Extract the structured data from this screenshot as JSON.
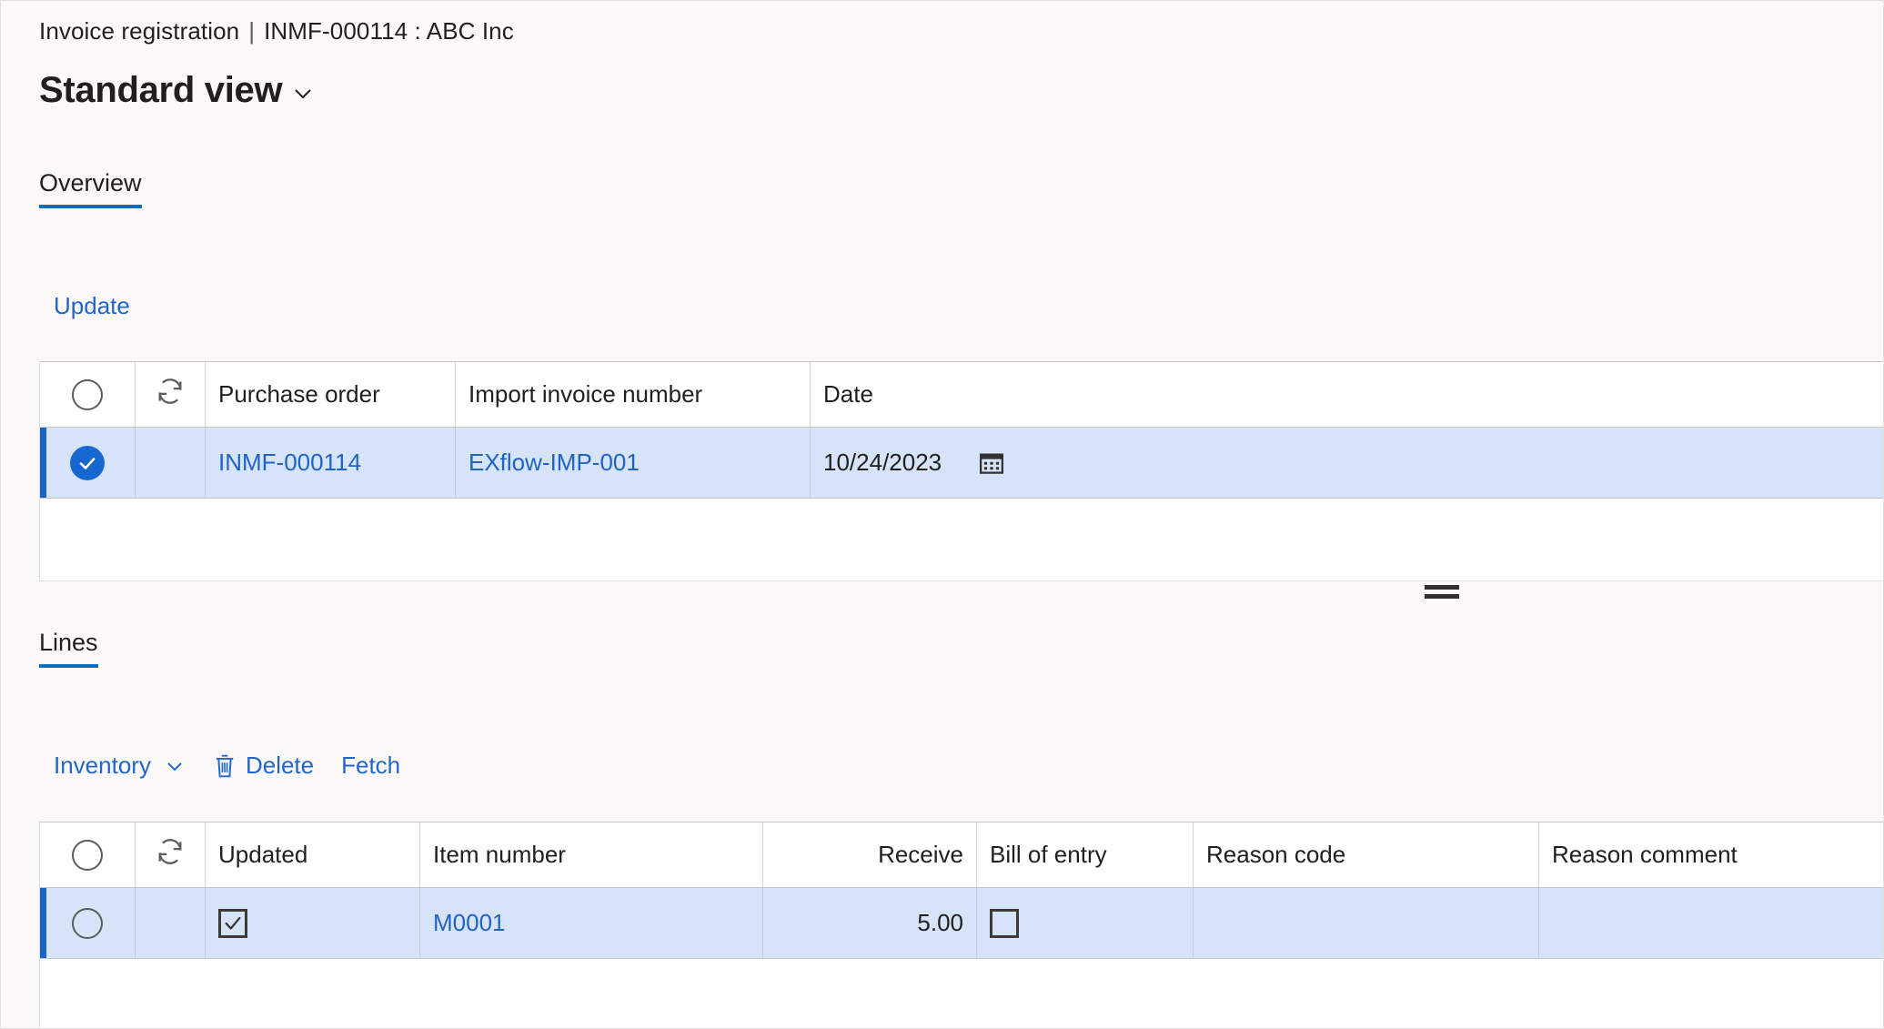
{
  "header": {
    "breadcrumb_primary": "Invoice registration",
    "breadcrumb_separator": "|",
    "breadcrumb_secondary": "INMF-000114 : ABC Inc",
    "page_title": "Standard view",
    "page_title_caret": "chevron-down-icon"
  },
  "tabs": [
    {
      "label": "Overview",
      "active": true
    }
  ],
  "overview": {
    "toolbar": {
      "update_label": "Update"
    },
    "grid": {
      "columns": [
        {
          "key": "select",
          "label": "",
          "icon": "circle-select-all-icon"
        },
        {
          "key": "refresh",
          "label": "",
          "icon": "refresh-icon"
        },
        {
          "key": "purchase_order",
          "label": "Purchase order"
        },
        {
          "key": "import_invoice_number",
          "label": "Import invoice number"
        },
        {
          "key": "date",
          "label": "Date"
        }
      ],
      "rows": [
        {
          "selected": true,
          "purchase_order": "INMF-000114",
          "import_invoice_number": "EXflow-IMP-001",
          "date": "10/24/2023",
          "date_icon": "calendar-icon"
        }
      ]
    }
  },
  "lines": {
    "tabs": [
      {
        "label": "Lines",
        "active": true
      }
    ],
    "toolbar": {
      "inventory_label": "Inventory",
      "inventory_caret": "chevron-down-icon",
      "delete_label": "Delete",
      "delete_icon": "trash-icon",
      "fetch_label": "Fetch"
    },
    "grid": {
      "columns": [
        {
          "key": "select",
          "label": "",
          "icon": "circle-select-all-icon"
        },
        {
          "key": "refresh",
          "label": "",
          "icon": "refresh-icon"
        },
        {
          "key": "updated",
          "label": "Updated"
        },
        {
          "key": "item_number",
          "label": "Item number"
        },
        {
          "key": "receive",
          "label": "Receive"
        },
        {
          "key": "bill_of_entry",
          "label": "Bill of entry"
        },
        {
          "key": "reason_code",
          "label": "Reason code"
        },
        {
          "key": "reason_comment",
          "label": "Reason comment"
        }
      ],
      "rows": [
        {
          "selected": false,
          "updated": true,
          "item_number": "M0001",
          "receive": "5.00",
          "bill_of_entry": false,
          "reason_code": "",
          "reason_comment": ""
        }
      ]
    }
  },
  "colors": {
    "accent": "#0f6cbd",
    "link": "#2266cc",
    "selected_row_bg": "#d7e3f8",
    "selected_row_bar": "#1a64c4",
    "page_bg": "#faf9f8"
  }
}
